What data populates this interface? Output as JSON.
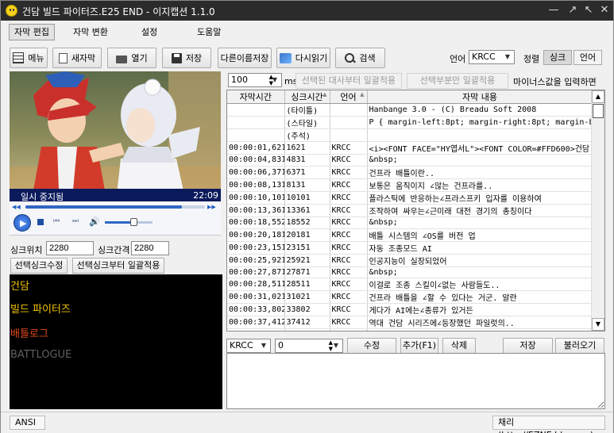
{
  "window": {
    "title": "건담 빌드 파이터즈.E25 END - 이지캡션 1.1.0",
    "controls": [
      "—",
      "↗",
      "↖",
      "✕"
    ]
  },
  "menu": {
    "tabs": [
      "자막 편집",
      "자막 변환",
      "설정",
      "도움말"
    ]
  },
  "toolbar": {
    "menu_label": "메뉴",
    "new_label": "새자막",
    "open_label": "열기",
    "save_label": "저장",
    "save_as_label": "다른이름저장",
    "reload_label": "다시읽기",
    "search_label": "검색",
    "language_label": "언어",
    "language_value": "KRCC",
    "sort_label": "정렬",
    "sort_sync_label": "싱크",
    "sort_lang_label": "언어"
  },
  "video": {
    "status_text": "일시 중지됨",
    "time_text": "22:09",
    "seek_fraction": 0.87,
    "volume_fraction": 0.6
  },
  "sync": {
    "position_label": "싱크위치",
    "position_value": "2280",
    "interval_label": "싱크간격",
    "interval_value": "2280",
    "apply_selected_label": "선택싱크수정",
    "apply_from_selected_label": "선택싱크부터 일괄적용"
  },
  "preview": {
    "lines": [
      {
        "text": "건담",
        "color": "#f2c200"
      },
      {
        "text": "빌드 파이터즈",
        "color": "#f2c200"
      },
      {
        "text": "배틀로그",
        "color": "#e2481b"
      },
      {
        "text": "BATTLOGUE",
        "color": "#5f5f5f"
      }
    ]
  },
  "offset_bar": {
    "value": "100",
    "unit": "ms",
    "apply_from_selected_label": "선택된 대사부터 일괄적용",
    "apply_selected_only_label": "선택부분만 일괄적용",
    "hint_text": "마이너스값을 입력하면"
  },
  "table": {
    "columns": [
      "자막시간",
      "싱크시간",
      "언어",
      "자막 내용"
    ],
    "rows": [
      [
        "",
        "(타이틀)",
        "",
        "Hanbange 3.0 - (C) Breadu Soft 2008"
      ],
      [
        "",
        "(스타일)",
        "",
        "P { margin-left:8pt; margin-right:8pt; margin-bottom:2"
      ],
      [
        "",
        "(주석)",
        "",
        ""
      ],
      [
        "00:00:01,621",
        "1621",
        "KRCC",
        "<i><FONT FACE=\"HY엽서L\"><FONT COLOR=#FFD600>건담"
      ],
      [
        "00:00:04,831",
        "4831",
        "KRCC",
        "&nbsp;"
      ],
      [
        "00:00:06,371",
        "6371",
        "KRCC",
        "건프라 배틀이란.."
      ],
      [
        "00:00:08,131",
        "8131",
        "KRCC",
        "보통은 움직이지 ∠않는 건프라를.."
      ],
      [
        "00:00:10,101",
        "10101",
        "KRCC",
        "플라스틱에 반응하는∠프라스프키 입자를 이용하여"
      ],
      [
        "00:00:13,361",
        "13361",
        "KRCC",
        "조작하여 싸우는∠근미래 대전 경기의 총칭이다"
      ],
      [
        "00:00:18,552",
        "18552",
        "KRCC",
        "&nbsp;"
      ],
      [
        "00:00:20,181",
        "20181",
        "KRCC",
        "배틀 시스템의 ∠OS를 버전 업"
      ],
      [
        "00:00:23,151",
        "23151",
        "KRCC",
        "자동 조종모드 AI"
      ],
      [
        "00:00:25,921",
        "25921",
        "KRCC",
        "인공지능이 실장되었어"
      ],
      [
        "00:00:27,871",
        "27871",
        "KRCC",
        "&nbsp;"
      ],
      [
        "00:00:28,511",
        "28511",
        "KRCC",
        "이걸로 조종 스킬이∠없는 사람들도.."
      ],
      [
        "00:00:31,021",
        "31021",
        "KRCC",
        "건프라 배틀을 ∠할 수 있다는 거군. 알란"
      ],
      [
        "00:00:33,802",
        "33802",
        "KRCC",
        "게다가 AI에는∠종류가 있거든"
      ],
      [
        "00:00:37,412",
        "37412",
        "KRCC",
        "역대 건담 시리즈에∠등장했던 파일럿의.."
      ],
      [
        "00:00:40,622",
        "40622",
        "KRCC",
        "유사 인격을∠선택할 수도 있어"
      ],
      [
        "00:00:43,352",
        "43352",
        "KRCC",
        "&nbsp;"
      ]
    ]
  },
  "edit_bar": {
    "language_value": "KRCC",
    "sync_value": "0",
    "modify_label": "수정",
    "add_label": "추가(F1)",
    "delete_label": "삭제",
    "save_label": "저장",
    "load_label": "불러오기"
  },
  "status": {
    "encoding": "ANSI",
    "credit": "채리 (http://EZNE.blog.me)"
  }
}
